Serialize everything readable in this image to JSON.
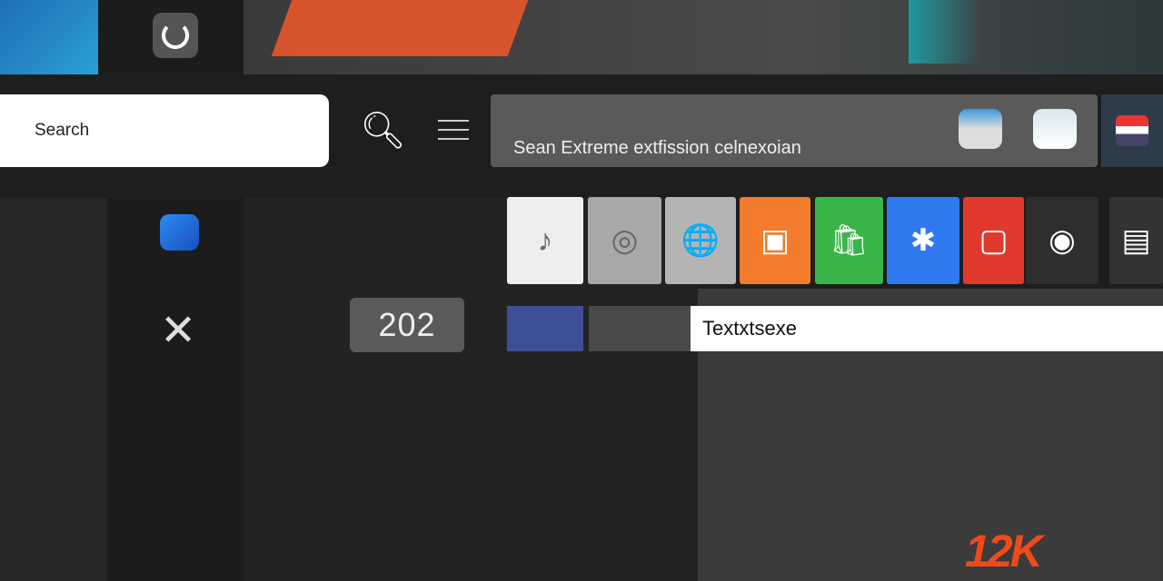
{
  "search": {
    "placeholder": "Search"
  },
  "address_bar": {
    "text": "Sean Extreme extfission celnexoian"
  },
  "counter": {
    "value": "202"
  },
  "text_field": {
    "value": "Textxtsexe"
  },
  "logo": {
    "text": "12K"
  },
  "app_tiles": [
    {
      "name": "white-app",
      "color": "#eeeeee",
      "glyph": "♪"
    },
    {
      "name": "spiral-app",
      "color": "#a8a8a8",
      "glyph": "◎"
    },
    {
      "name": "globe-app",
      "color": "#b4b4b4",
      "glyph": "🌐"
    },
    {
      "name": "orange-app",
      "color": "#f27b2c",
      "glyph": "▣"
    },
    {
      "name": "bag-app",
      "color": "#3ab54a",
      "glyph": "🛍"
    },
    {
      "name": "blue-app",
      "color": "#2e79ee",
      "glyph": "✱"
    },
    {
      "name": "red-app",
      "color": "#e0392e",
      "glyph": "▢"
    },
    {
      "name": "dark-app",
      "color": "#2e2e2e",
      "glyph": "◉"
    },
    {
      "name": "edge-app",
      "color": "#333333",
      "glyph": "▤"
    }
  ]
}
